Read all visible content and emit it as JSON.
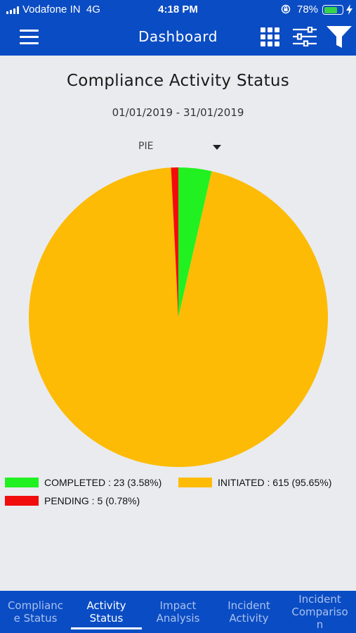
{
  "status_bar": {
    "carrier": "Vodafone IN",
    "network": "4G",
    "time": "4:18 PM",
    "battery_percent": "78%",
    "battery_level": 0.78
  },
  "header": {
    "title": "Dashboard",
    "icons": [
      "menu-icon",
      "grid-icon",
      "sliders-icon",
      "filter-icon"
    ]
  },
  "main": {
    "title": "Compliance Activity Status",
    "date_range": "01/01/2019 - 31/01/2019",
    "chart_type_select": "PIE"
  },
  "chart_data": {
    "type": "pie",
    "slices": [
      {
        "label": "COMPLETED",
        "value": 23,
        "percent": 3.58,
        "color": "#21f121"
      },
      {
        "label": "INITIATED",
        "value": 615,
        "percent": 95.65,
        "color": "#fdbb05"
      },
      {
        "label": "PENDING",
        "value": 5,
        "percent": 0.78,
        "color": "#f20d0d"
      }
    ],
    "legend": [
      {
        "text": "COMPLETED : 23 (3.58%)",
        "color": "#21f121"
      },
      {
        "text": "INITIATED : 615 (95.65%)",
        "color": "#fdbb05"
      },
      {
        "text": "PENDING : 5 (0.78%)",
        "color": "#f20d0d"
      }
    ],
    "legend_position": "bottom"
  },
  "bottom_tabs": [
    {
      "label_lines": [
        "Complianc",
        "e Status"
      ],
      "active": false
    },
    {
      "label_lines": [
        "Activity",
        "Status"
      ],
      "active": true
    },
    {
      "label_lines": [
        "Impact",
        "Analysis"
      ],
      "active": false
    },
    {
      "label_lines": [
        "Incident",
        "Activity"
      ],
      "active": false
    },
    {
      "label_lines": [
        "Incident",
        "Compariso",
        "n"
      ],
      "active": false
    }
  ],
  "colors": {
    "brand_blue": "#0a4cc3",
    "background": "#e9ebee",
    "tab_inactive_text": "#aac2ef"
  }
}
